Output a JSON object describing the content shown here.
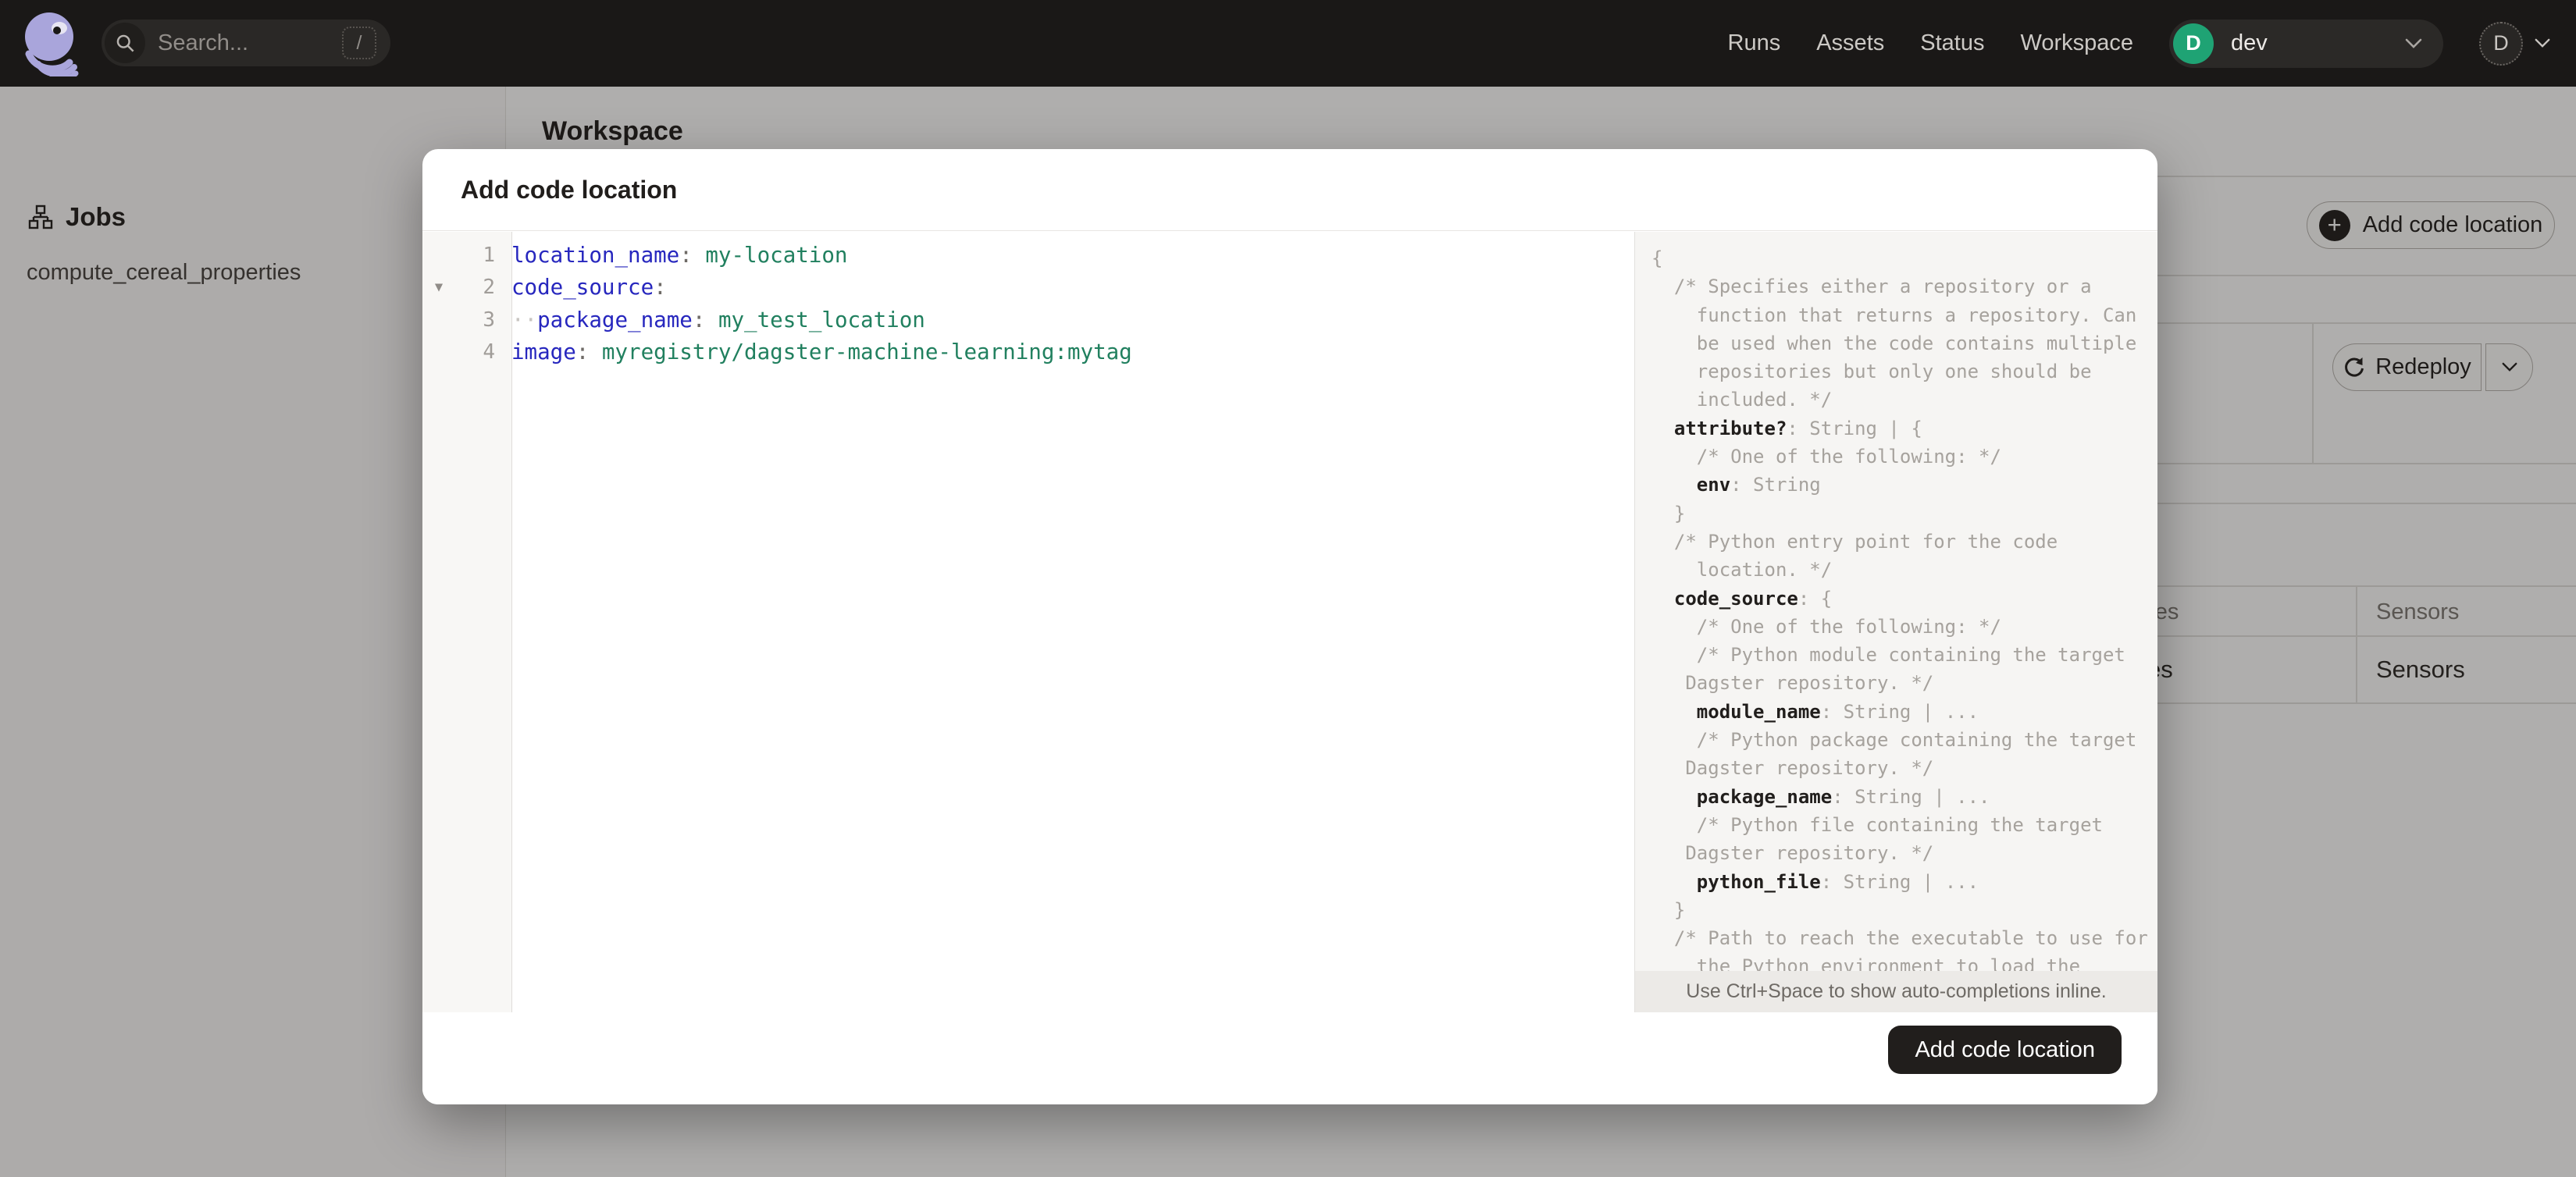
{
  "navbar": {
    "search": {
      "placeholder": "Search...",
      "shortcut": "/"
    },
    "links": [
      "Runs",
      "Assets",
      "Status",
      "Workspace"
    ],
    "deployment": {
      "initial": "D",
      "name": "dev"
    },
    "user_initial": "D"
  },
  "sidebar": {
    "section_label": "Jobs",
    "items": [
      "compute_cereal_properties"
    ]
  },
  "background": {
    "page_title": "Workspace",
    "add_button_label": "Add code location",
    "plus_glyph": "+",
    "redeploy_label": "Redeploy",
    "table_header": [
      "Schedules",
      "Sensors"
    ],
    "table_row": [
      "Schedules",
      "Sensors"
    ]
  },
  "modal": {
    "title": "Add code location",
    "editor": {
      "lines": [
        {
          "num": "1",
          "fold": false,
          "tokens": [
            [
              "key",
              "location_name"
            ],
            [
              "punc",
              ": "
            ],
            [
              "val",
              "my-location"
            ]
          ]
        },
        {
          "num": "2",
          "fold": true,
          "tokens": [
            [
              "key",
              "code_source"
            ],
            [
              "punc",
              ":"
            ]
          ]
        },
        {
          "num": "3",
          "fold": false,
          "tokens": [
            [
              "ws",
              "··"
            ],
            [
              "key",
              "package_name"
            ],
            [
              "punc",
              ": "
            ],
            [
              "val",
              "my_test_location"
            ]
          ]
        },
        {
          "num": "4",
          "fold": false,
          "tokens": [
            [
              "key",
              "image"
            ],
            [
              "punc",
              ": "
            ],
            [
              "val",
              "myregistry/dagster-machine-learning:mytag"
            ]
          ]
        }
      ],
      "fold_glyph": "▼"
    },
    "schema": {
      "lines": [
        [
          [
            "punc",
            "{"
          ]
        ],
        [
          [
            "cm",
            "  /* Specifies either a repository or a"
          ]
        ],
        [
          [
            "cm",
            "    function that returns a repository. Can"
          ]
        ],
        [
          [
            "cm",
            "    be used when the code contains multiple"
          ]
        ],
        [
          [
            "cm",
            "    repositories but only one should be"
          ]
        ],
        [
          [
            "cm",
            "    included. */"
          ]
        ],
        [
          [
            "key",
            "  attribute?"
          ],
          [
            "type",
            ": String | {"
          ]
        ],
        [
          [
            "cm",
            "    /* One of the following: */"
          ]
        ],
        [
          [
            "key",
            "    env"
          ],
          [
            "type",
            ": String"
          ]
        ],
        [
          [
            "punc",
            "  }"
          ]
        ],
        [
          [
            "cm",
            "  /* Python entry point for the code"
          ]
        ],
        [
          [
            "cm",
            "    location. */"
          ]
        ],
        [
          [
            "key",
            "  code_source"
          ],
          [
            "type",
            ": {"
          ]
        ],
        [
          [
            "cm",
            "    /* One of the following: */"
          ]
        ],
        [
          [
            "cm",
            "    /* Python module containing the target"
          ]
        ],
        [
          [
            "cm",
            "   Dagster repository. */"
          ]
        ],
        [
          [
            "key",
            "    module_name"
          ],
          [
            "type",
            ": String | ..."
          ]
        ],
        [
          [
            "cm",
            "    /* Python package containing the target"
          ]
        ],
        [
          [
            "cm",
            "   Dagster repository. */"
          ]
        ],
        [
          [
            "key",
            "    package_name"
          ],
          [
            "type",
            ": String | ..."
          ]
        ],
        [
          [
            "cm",
            "    /* Python file containing the target"
          ]
        ],
        [
          [
            "cm",
            "   Dagster repository. */"
          ]
        ],
        [
          [
            "key",
            "    python_file"
          ],
          [
            "type",
            ": String | ..."
          ]
        ],
        [
          [
            "punc",
            "  }"
          ]
        ],
        [
          [
            "cm",
            "  /* Path to reach the executable to use for"
          ]
        ],
        [
          [
            "cm",
            "    the Python environment to load the"
          ]
        ]
      ]
    },
    "hint": "Use Ctrl+Space to show auto-completions inline.",
    "submit_label": "Add code location"
  },
  "colors": {
    "navbar_bg": "#1A1817",
    "accent_green": "#1FA374",
    "code_key": "#2727BE",
    "code_value": "#21805F",
    "code_comment": "#A6A29D",
    "primary_button_bg": "#211E1C",
    "panel_bg": "#F6F5F3"
  }
}
